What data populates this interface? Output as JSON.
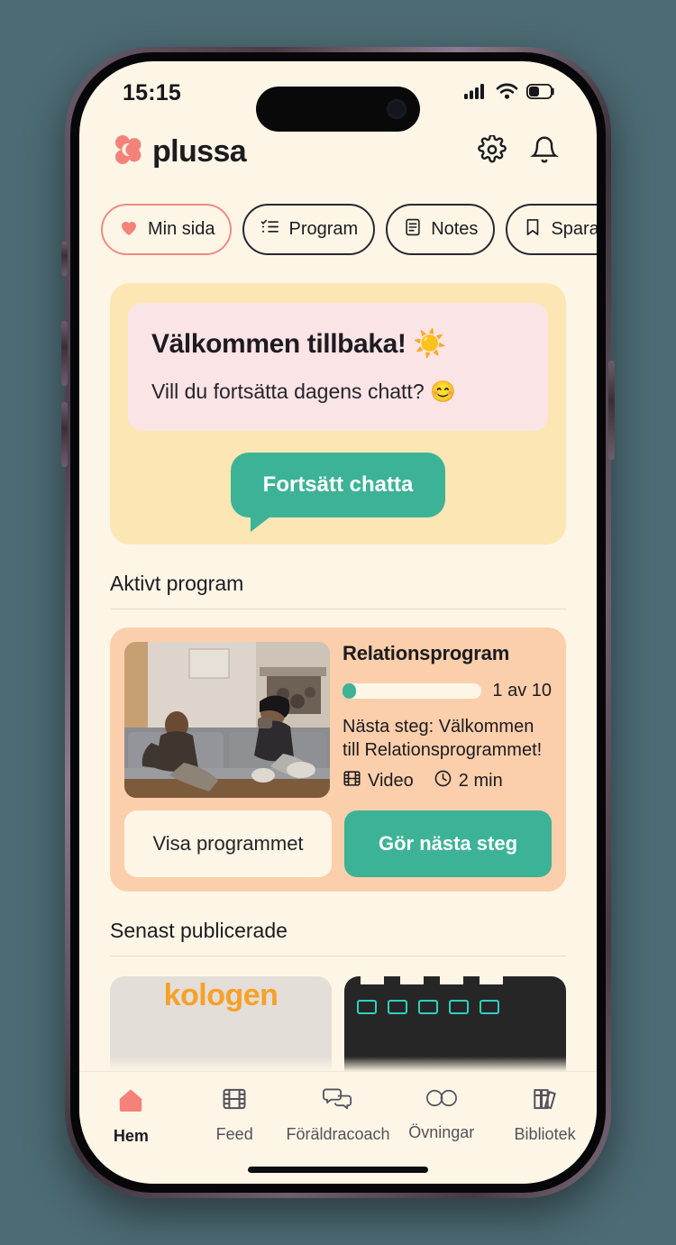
{
  "device": {
    "status_bar": {
      "time": "15:15",
      "cellular_icon": "cellular-bars-icon",
      "wifi_icon": "wifi-icon",
      "battery_icon": "battery-icon",
      "battery_level_pct": 42
    },
    "home_indicator": "home-indicator"
  },
  "header": {
    "logo_text": "plussa",
    "logo_icon": "plussa-clover-logo",
    "settings_icon": "gear-icon",
    "notifications_icon": "bell-icon"
  },
  "chips": [
    {
      "label": "Min sida",
      "icon": "heart-icon",
      "active": true
    },
    {
      "label": "Program",
      "icon": "checklist-icon",
      "active": false
    },
    {
      "label": "Notes",
      "icon": "document-icon",
      "active": false
    },
    {
      "label": "Sparade",
      "icon": "bookmark-icon",
      "active": false
    }
  ],
  "welcome": {
    "title": "Välkommen tillbaka! ☀️",
    "subtitle": "Vill du fortsätta dagens chatt? 😊",
    "cta_label": "Fortsätt chatta"
  },
  "active_program_section": {
    "heading": "Aktivt program",
    "card": {
      "title": "Relationsprogram",
      "thumbnail_alt": "couple-on-sofa-photo",
      "progress_label": "1 av 10",
      "progress_current": 1,
      "progress_total": 10,
      "next_step": "Nästa steg: Välkommen till Relationsprogrammet!",
      "media_type": "Video",
      "media_icon": "film-icon",
      "duration": "2 min",
      "duration_icon": "clock-icon",
      "secondary_button": "Visa programmet",
      "primary_button": "Gör nästa steg"
    }
  },
  "latest_section": {
    "heading": "Senast publicerade",
    "peek_cards": [
      {
        "name": "peek-card-left",
        "partial_text": "kologen"
      },
      {
        "name": "peek-card-right",
        "partial_text": ""
      }
    ]
  },
  "tabbar": [
    {
      "label": "Hem",
      "icon": "home-icon",
      "active": true
    },
    {
      "label": "Feed",
      "icon": "film-icon",
      "active": false
    },
    {
      "label": "Föräldracoach",
      "icon": "chat-bubbles-icon",
      "active": false
    },
    {
      "label": "Övningar",
      "icon": "infinity-icon",
      "active": false
    },
    {
      "label": "Bibliotek",
      "icon": "books-icon",
      "active": false
    }
  ],
  "colors": {
    "page_background": "#4d6b74",
    "screen_background": "#fdf6e6",
    "accent_coral": "#f08a84",
    "accent_teal": "#3cb396",
    "welcome_card": "#fce6b4",
    "welcome_inner": "#fbe4e6",
    "program_card": "#fbcfab"
  }
}
